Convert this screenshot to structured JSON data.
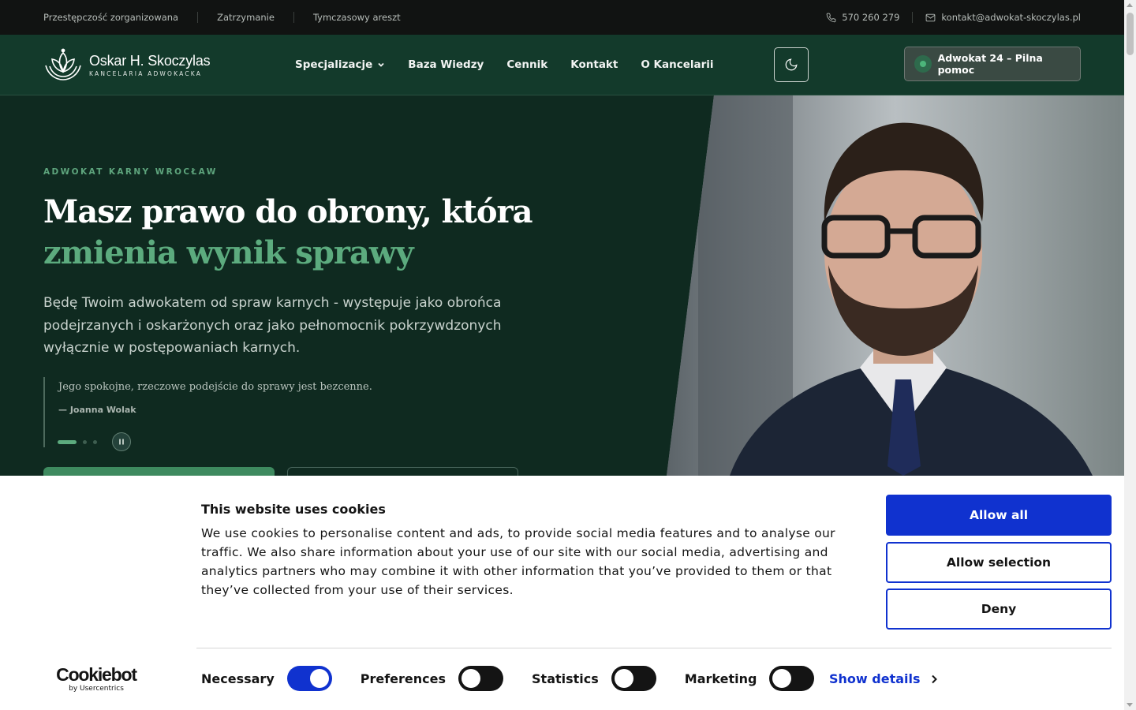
{
  "topbar": {
    "links": [
      "Przestępczość zorganizowana",
      "Zatrzymanie",
      "Tymczasowy areszt"
    ],
    "phone": "570 260 279",
    "email": "kontakt@adwokat-skoczylas.pl"
  },
  "header": {
    "logo_name": "Oskar H. Skoczylas",
    "logo_sub": "KANCELARIA ADWOKACKA",
    "nav": [
      "Specjalizacje",
      "Baza Wiedzy",
      "Cennik",
      "Kontakt",
      "O Kancelarii"
    ],
    "urgent_label": "Adwokat 24 – Pilna pomoc"
  },
  "hero": {
    "eyebrow": "ADWOKAT KARNY WROCŁAW",
    "headline_main": "Masz prawo do obrony, która ",
    "headline_accent": "zmienia wynik sprawy",
    "lead": "Będę Twoim adwokatem od spraw karnych - występuje jako obrońca podejrzanych i oskarżonych oraz jako pełnomocnik pokrzywdzonych wyłącznie w postępowaniach karnych.",
    "quote_text": "Jego spokojne, rzeczowe podejście do sprawy jest bezcenne.",
    "quote_author": "— Joanna Wolak"
  },
  "cookie": {
    "title": "This website uses cookies",
    "body": "We use cookies to personalise content and ads, to provide social media features and to analyse our traffic. We also share information about your use of our site with our social media, advertising and analytics partners who may combine it with other information that you’ve provided to them or that they’ve collected from your use of their services.",
    "allow_all": "Allow all",
    "allow_selection": "Allow selection",
    "deny": "Deny",
    "toggles": [
      {
        "label": "Necessary",
        "on": true
      },
      {
        "label": "Preferences",
        "on": false
      },
      {
        "label": "Statistics",
        "on": false
      },
      {
        "label": "Marketing",
        "on": false
      }
    ],
    "show_details": "Show details",
    "brand": "Cookiebot",
    "brand_sub": "by Usercentrics"
  },
  "colors": {
    "accent_green": "#5cab7e",
    "cookie_blue": "#1032cf",
    "hero_bg": "#0f2a20"
  }
}
